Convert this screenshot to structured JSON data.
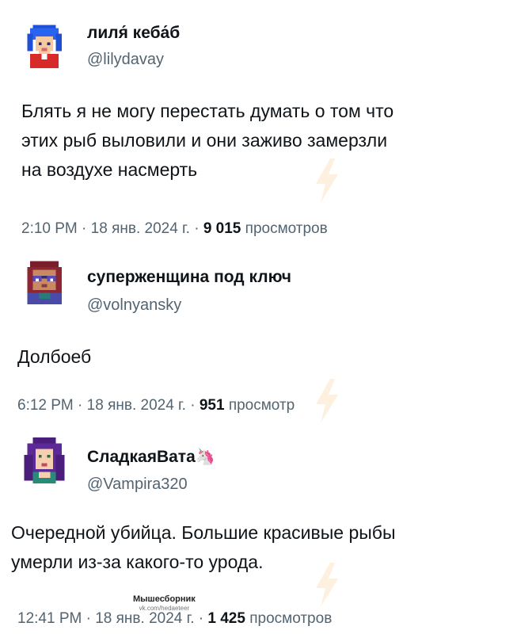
{
  "tweets": [
    {
      "name": "лиля́ кеба́б",
      "handle": "@lilydavay",
      "text_lines": [
        "Блять я не могу перестать думать о том что",
        "этих рыб выловили и они заживо замерзли",
        "на воздухе насмерть"
      ],
      "time": "2:10 PM",
      "date": "18 янв. 2024 г.",
      "views_count": "9 015",
      "views_label": "просмотров",
      "separator": "·",
      "avatar_icon": "pixel-avatar-blue-hair-icon"
    },
    {
      "name": "суперженщина под ключ",
      "handle": "@volnyansky",
      "text_lines": [
        "Долбоеб"
      ],
      "time": "6:12 PM",
      "date": "18 янв. 2024 г.",
      "views_count": "951",
      "views_label": "просмотр",
      "separator": "·",
      "avatar_icon": "pixel-avatar-glasses-icon"
    },
    {
      "name": "СладкаяВата",
      "name_emoji": "🦄",
      "handle": "@Vampira320",
      "text_lines": [
        "Очередной убийца. Большие красивые рыбы",
        "умерли из-за какого-то урода."
      ],
      "time": "12:41 PM",
      "date": "18 янв. 2024 г.",
      "views_count": "1 425",
      "views_label": "просмотров",
      "separator": "·",
      "avatar_icon": "pixel-avatar-purple-hair-icon"
    }
  ],
  "watermark": {
    "title": "Мышесборник",
    "sub": "vk.com/hedaeteer"
  },
  "colors": {
    "text": "#0f1419",
    "secondary": "#536471",
    "background": "#ffffff"
  }
}
